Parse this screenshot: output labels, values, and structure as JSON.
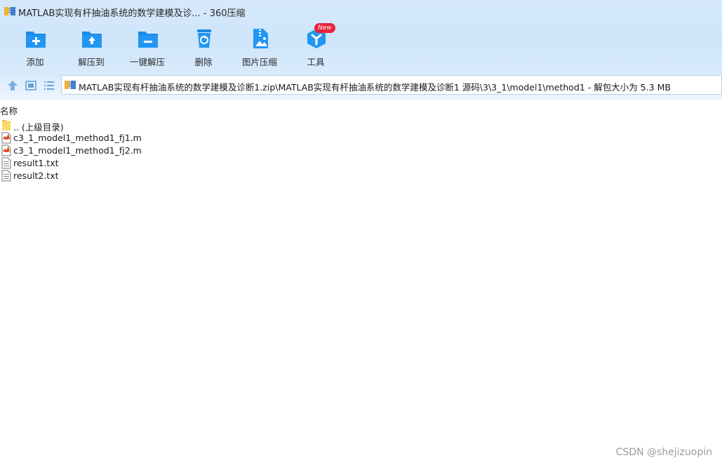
{
  "window": {
    "title": "MATLAB实现有杆抽油系统的数学建模及诊... - 360压缩",
    "app_icon": "zip-archive-icon"
  },
  "toolbar": {
    "buttons": [
      {
        "label": "添加",
        "icon": "add-icon"
      },
      {
        "label": "解压到",
        "icon": "extract-to-icon"
      },
      {
        "label": "一键解压",
        "icon": "one-click-extract-icon"
      },
      {
        "label": "删除",
        "icon": "delete-icon"
      },
      {
        "label": "图片压缩",
        "icon": "image-compress-icon"
      },
      {
        "label": "工具",
        "icon": "tools-icon",
        "badge": "New"
      }
    ]
  },
  "nav": {
    "up_icon": "up-arrow-icon",
    "view_thumb_icon": "thumbnail-view-icon",
    "view_list_icon": "list-view-icon"
  },
  "address": {
    "path": "MATLAB实现有杆抽油系统的数学建模及诊断1.zip\\MATLAB实现有杆抽油系统的数学建模及诊断1 源码\\3\\3_1\\model1\\method1 - 解包大小为 5.3 MB"
  },
  "file_list": {
    "column_name": "名称",
    "items": [
      {
        "name": ".. (上级目录)",
        "type": "folder"
      },
      {
        "name": "c3_1_model1_method1_fj1.m",
        "type": "matlab"
      },
      {
        "name": "c3_1_model1_method1_fj2.m",
        "type": "matlab"
      },
      {
        "name": "result1.txt",
        "type": "text"
      },
      {
        "name": "result2.txt",
        "type": "text"
      }
    ]
  },
  "watermark": "CSDN @shejizuopin",
  "colors": {
    "accent": "#1e88e5",
    "header_bg": "#d5e9fb",
    "badge": "#e8223a"
  }
}
